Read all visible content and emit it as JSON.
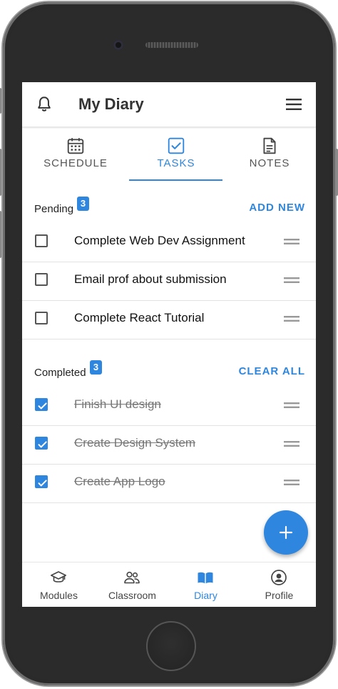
{
  "app": {
    "title": "My Diary"
  },
  "tabs": [
    {
      "label": "SCHEDULE",
      "icon": "calendar-icon",
      "active": false
    },
    {
      "label": "TASKS",
      "icon": "checkbox-icon",
      "active": true
    },
    {
      "label": "NOTES",
      "icon": "document-icon",
      "active": false
    }
  ],
  "pending": {
    "label": "Pending",
    "count": "3",
    "action": "ADD NEW",
    "items": [
      {
        "text": "Complete Web Dev Assignment",
        "checked": false
      },
      {
        "text": "Email prof about submission",
        "checked": false
      },
      {
        "text": "Complete React Tutorial",
        "checked": false
      }
    ]
  },
  "completed": {
    "label": "Completed",
    "count": "3",
    "action": "CLEAR ALL",
    "items": [
      {
        "text": "Finish UI design",
        "checked": true
      },
      {
        "text": "Create Design System",
        "checked": true
      },
      {
        "text": "Create App Logo",
        "checked": true
      }
    ]
  },
  "bottom_nav": [
    {
      "label": "Modules",
      "icon": "graduation-cap-icon",
      "active": false
    },
    {
      "label": "Classroom",
      "icon": "people-icon",
      "active": false
    },
    {
      "label": "Diary",
      "icon": "book-icon",
      "active": true
    },
    {
      "label": "Profile",
      "icon": "user-circle-icon",
      "active": false
    }
  ],
  "colors": {
    "accent": "#2e86de",
    "frame": "#2b2b2b"
  }
}
